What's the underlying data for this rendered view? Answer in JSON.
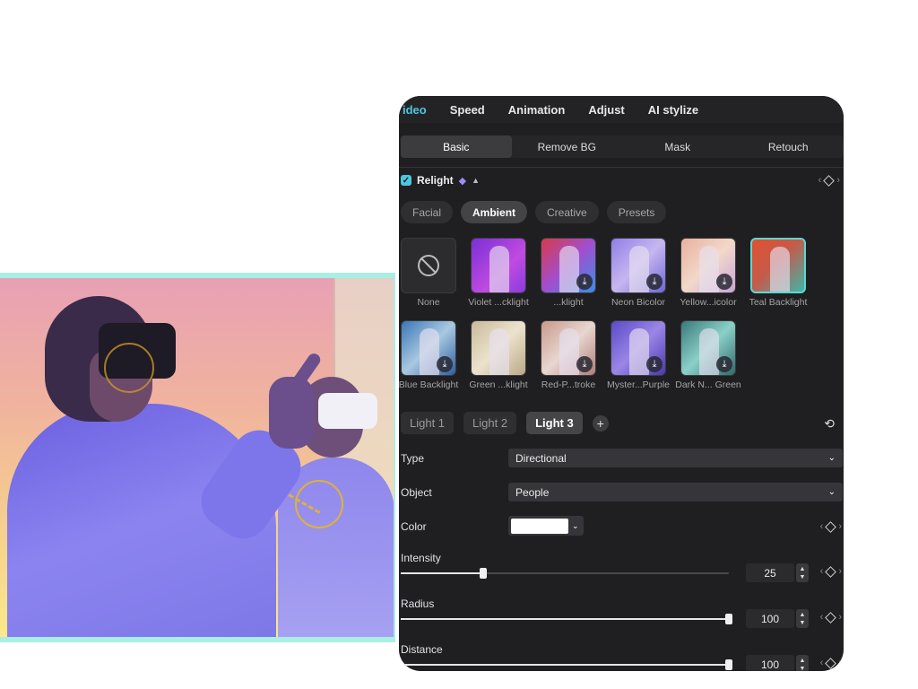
{
  "colors": {
    "accent": "#4fc6dd",
    "panel_bg": "#1f1f21",
    "border_highlight": "#a9efe4",
    "selected_preset_border": "#5fd6cf",
    "marker": "#e0b236"
  },
  "top_tabs": [
    {
      "label": "ideo",
      "active": true
    },
    {
      "label": "Speed",
      "active": false
    },
    {
      "label": "Animation",
      "active": false
    },
    {
      "label": "Adjust",
      "active": false
    },
    {
      "label": "AI stylize",
      "active": false
    }
  ],
  "sub_tabs": [
    {
      "label": "Basic",
      "active": true
    },
    {
      "label": "Remove BG",
      "active": false
    },
    {
      "label": "Mask",
      "active": false
    },
    {
      "label": "Retouch",
      "active": false
    }
  ],
  "relight": {
    "label": "Relight",
    "enabled": true,
    "icons": [
      "check-icon",
      "gem-icon",
      "caret-up-icon"
    ]
  },
  "categories": [
    {
      "label": "Facial",
      "active": false
    },
    {
      "label": "Ambient",
      "active": true
    },
    {
      "label": "Creative",
      "active": false
    },
    {
      "label": "Presets",
      "active": false
    }
  ],
  "presets": [
    {
      "label": "None",
      "bg": "#2c2c2f",
      "download": false
    },
    {
      "label": "Violet ...cklight",
      "bg": "linear-gradient(135deg,#7a2fd6,#c04be0 60%,#8a3ae0)",
      "download": false
    },
    {
      "label": "...klight",
      "bg": "linear-gradient(135deg,#d83a4a,#a04fd0 50%,#3a8ee6)",
      "download": true
    },
    {
      "label": "Neon Bicolor",
      "bg": "linear-gradient(135deg,#8f7fe8,#c7b6f0 50%,#6f66d8)",
      "download": true
    },
    {
      "label": "Yellow...icolor",
      "bg": "linear-gradient(135deg,#e9b0a0,#f2d8c8 50%,#c9a6d6)",
      "download": true
    },
    {
      "label": "Teal Backlight",
      "bg": "linear-gradient(135deg,#e0522e,#c65a4a 45%,#3fb6a8)",
      "download": false,
      "selected": true
    },
    {
      "label": "Blue Backlight",
      "bg": "linear-gradient(135deg,#3a76b8,#a9c8e0 50%,#2d5fa0)",
      "download": true
    },
    {
      "label": "Green ...klight",
      "bg": "linear-gradient(135deg,#c9b99a,#ece2cc 50%,#b8a886)",
      "download": false
    },
    {
      "label": "Red-P...troke",
      "bg": "linear-gradient(135deg,#c99a8a,#e8d6d0 50%,#b07e78)",
      "download": true
    },
    {
      "label": "Myster...Purple",
      "bg": "linear-gradient(135deg,#5a4ac8,#9a86e6 50%,#4a38b0)",
      "download": true
    },
    {
      "label": "Dark N... Green",
      "bg": "linear-gradient(135deg,#3a7a7a,#8ad0c8 50%,#2f6a6c)",
      "download": true
    }
  ],
  "lights": [
    {
      "label": "Light 1",
      "active": false
    },
    {
      "label": "Light 2",
      "active": false
    },
    {
      "label": "Light 3",
      "active": true
    }
  ],
  "add_light_symbol": "+",
  "reset_symbol": "⟲",
  "fields": {
    "type": {
      "label": "Type",
      "value": "Directional"
    },
    "object": {
      "label": "Object",
      "value": "People"
    },
    "color": {
      "label": "Color",
      "value": "#ffffff"
    }
  },
  "sliders": [
    {
      "label": "Intensity",
      "value": "25",
      "fraction": 0.25
    },
    {
      "label": "Radius",
      "value": "100",
      "fraction": 1.0
    },
    {
      "label": "Distance",
      "value": "100",
      "fraction": 1.0
    }
  ]
}
